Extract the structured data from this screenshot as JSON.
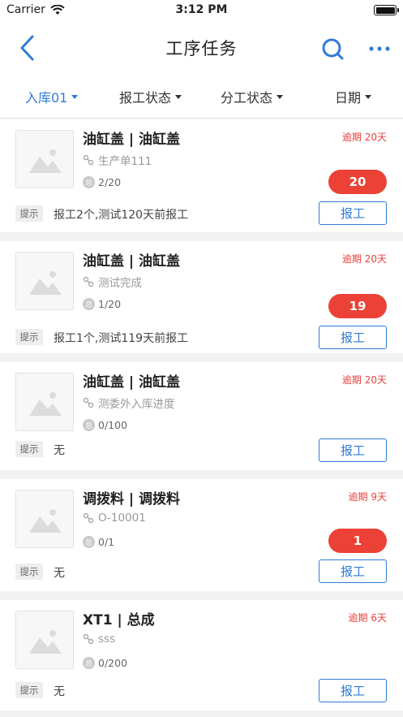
{
  "status_bar": {
    "carrier": "Carrier",
    "time": "3:12 PM"
  },
  "nav": {
    "title": "工序任务"
  },
  "filters": [
    {
      "label": "入库01"
    },
    {
      "label": "报工状态"
    },
    {
      "label": "分工状态"
    },
    {
      "label": "日期"
    }
  ],
  "colors": {
    "accent": "#2f7bd4",
    "danger": "#ec4136",
    "overdue": "#e8413c"
  },
  "hint_label": "提示",
  "report_label": "报工",
  "count_icon": "总",
  "tasks": [
    {
      "title": "油缸盖 | 油缸盖",
      "subtitle": "生产单111",
      "count": "2/20",
      "overdue": "逾期 20天",
      "badge": "20",
      "hint": "报工2个,测试120天前报工"
    },
    {
      "title": "油缸盖 | 油缸盖",
      "subtitle": "测试完成",
      "count": "1/20",
      "overdue": "逾期 20天",
      "badge": "19",
      "hint": "报工1个,测试119天前报工"
    },
    {
      "title": "油缸盖 | 油缸盖",
      "subtitle": "测委外入库进度",
      "count": "0/100",
      "overdue": "逾期 20天",
      "badge": "",
      "hint": "无"
    },
    {
      "title": "调拨料 | 调拨料",
      "subtitle": "O-10001",
      "count": "0/1",
      "overdue": "逾期 9天",
      "badge": "1",
      "hint": "无"
    },
    {
      "title": "XT1 | 总成",
      "subtitle": "sss",
      "count": "0/200",
      "overdue": "逾期 6天",
      "badge": "",
      "hint": "无"
    }
  ]
}
